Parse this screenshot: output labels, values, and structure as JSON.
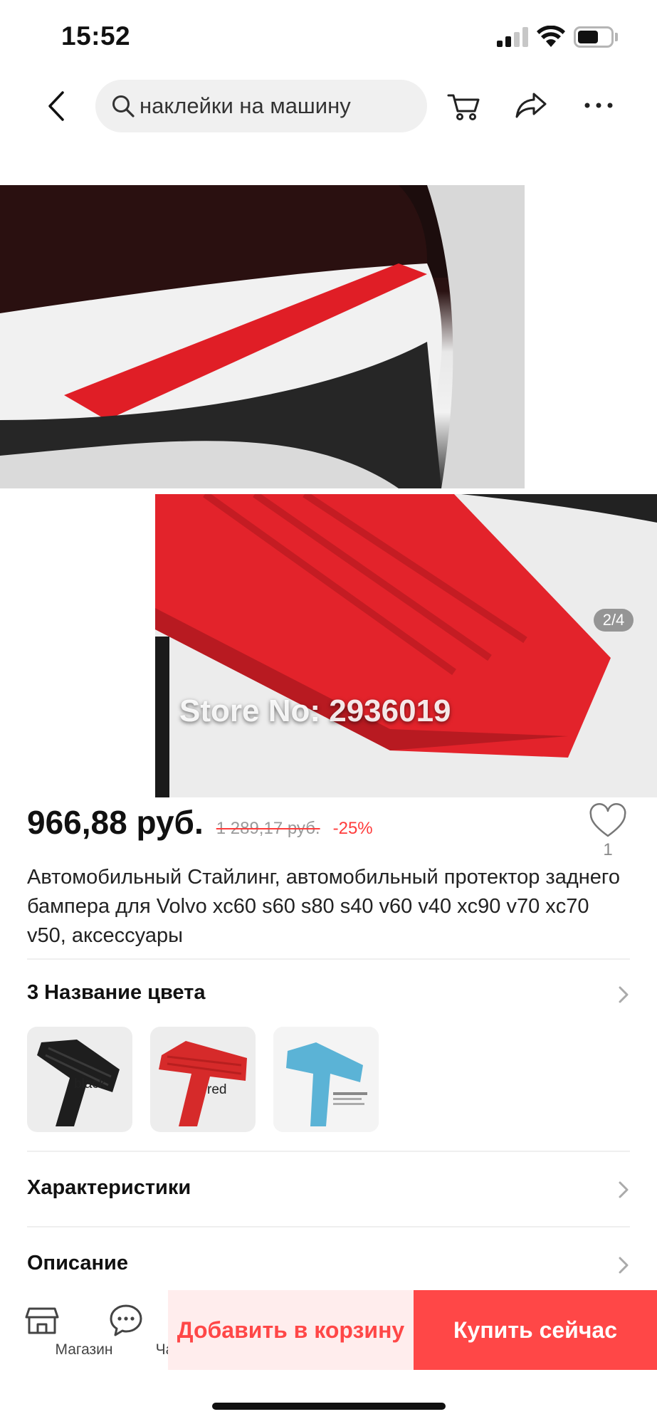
{
  "status_bar": {
    "time": "15:52"
  },
  "header": {
    "search_text": "наклейки на машину",
    "icons": [
      "back-icon",
      "search-icon",
      "cart-icon",
      "share-icon",
      "more-icon"
    ]
  },
  "gallery": {
    "watermark": "Store No: 2936019",
    "counter": "2/4"
  },
  "product": {
    "price": "966,88 руб.",
    "old_price": "1 289,17 руб.",
    "discount": "-25%",
    "wishlist_count": "1",
    "title": "Автомобильный Стайлинг, автомобильный протектор заднего бампера для Volvo xc60 s60 s80 s40 v60 v40 xc90 v70 xc70 v50, аксессуары"
  },
  "color_section": {
    "title": "3 Название цвета",
    "swatches": [
      {
        "label": "black",
        "color": "#1e1e1e"
      },
      {
        "label": "red",
        "color": "#d62a2a"
      },
      {
        "label": "",
        "color": "#5bb3d6"
      }
    ]
  },
  "sections": {
    "specs": "Характеристики",
    "description": "Описание"
  },
  "bottom_bar": {
    "store_label": "Магазин",
    "chat_label": "Чат",
    "add_to_cart": "Добавить в корзину",
    "buy_now": "Купить сейчас"
  },
  "colors": {
    "accent": "#ff4747",
    "accent_light": "#ffeded",
    "discount": "#ff3b3b"
  }
}
